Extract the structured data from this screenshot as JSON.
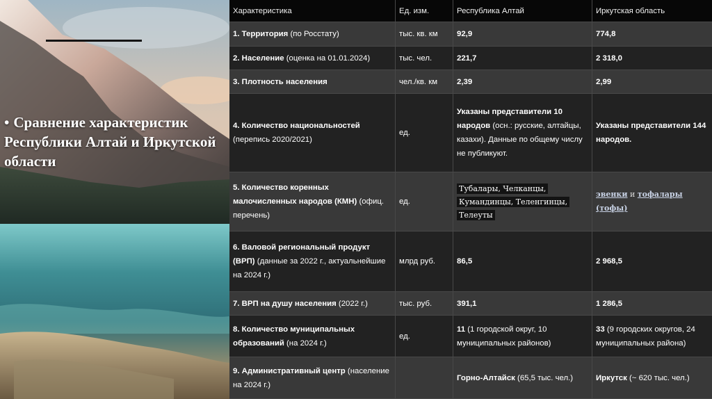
{
  "slide": {
    "title_bullet": "•",
    "title": "Сравнение характеристик Республики Алтай и Иркутской области"
  },
  "table": {
    "headers": [
      "Характеристика",
      "Ед. изм.",
      "Республика Алтай",
      "Иркутская область"
    ],
    "rows": [
      {
        "name_bold": "1. Территория",
        "name_rest": " (по Росстату)",
        "unit": "тыс. кв. км",
        "altai": "92,9",
        "irkutsk": "774,8"
      },
      {
        "name_bold": "2. Население",
        "name_rest": " (оценка на 01.01.2024)",
        "unit": "тыс. чел.",
        "altai": "221,7",
        "irkutsk": "2 318,0"
      },
      {
        "name_bold": "3. Плотность населения",
        "name_rest": "",
        "unit": "чел./кв. км",
        "altai": "2,39",
        "irkutsk": "2,99"
      },
      {
        "name_bold": "4. Количество национальностей",
        "name_rest": " (перепись 2020/2021)",
        "unit": "ед.",
        "altai_bold": "Указаны представители 10 народов",
        "altai_rest": " (осн.: русские, алтайцы, казахи). Данные по общему числу не публикуют.",
        "irkutsk_bold": "Указаны представители 144 народов."
      },
      {
        "name_bold": "5. Количество коренных малочисленных народов (КМН)",
        "name_rest": " (офиц. перечень)",
        "unit": "ед.",
        "altai_lines": [
          "Тубалары, Челканцы,",
          "Кумандинцы, Теленгинцы,",
          "Телеуты"
        ],
        "irkutsk_link1": "эвенки",
        "irkutsk_sep": " и ",
        "irkutsk_link2": "тофалары (тофы)"
      },
      {
        "name_bold": "6. Валовой региональный продукт (ВРП)",
        "name_rest": " (данные за 2022 г., актуальнейшие на 2024 г.)",
        "unit": "млрд руб.",
        "altai": "86,5",
        "irkutsk": "2 968,5"
      },
      {
        "name_bold": "7. ВРП на душу населения",
        "name_rest": " (2022 г.)",
        "unit": "тыс. руб.",
        "altai": "391,1",
        "irkutsk": "1 286,5"
      },
      {
        "name_bold": "8. Количество муниципальных образований",
        "name_rest": " (на 2024 г.)",
        "unit": "ед.",
        "altai_bold": "11",
        "altai_rest": " (1 городской округ, 10 муниципальных районов)",
        "irkutsk_bold": "33",
        "irkutsk_rest": " (9 городских округов, 24 муниципальных района)"
      },
      {
        "name_bold": "9. Административный центр",
        "name_rest": " (население на 2024 г.)",
        "unit": "",
        "altai_bold": "Горно-Алтайск",
        "altai_rest": " (65,5 тыс. чел.)",
        "irkutsk_bold": "Иркутск",
        "irkutsk_rest": " (~ 620 тыс. чел.)"
      }
    ]
  }
}
